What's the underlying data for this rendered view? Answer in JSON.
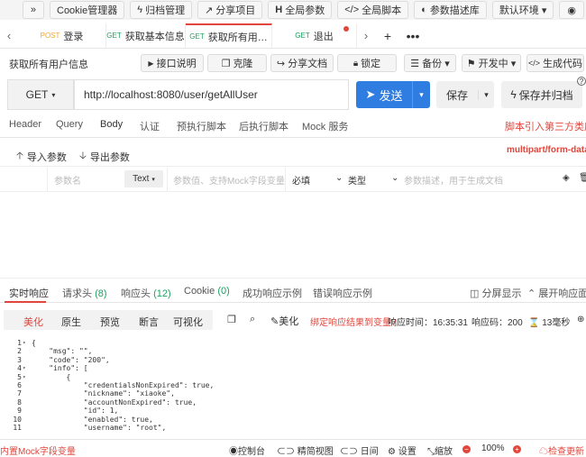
{
  "topbar": {
    "items": [
      {
        "icon": "»",
        "label": ""
      },
      {
        "icon": "",
        "label": "Cookie管理器"
      },
      {
        "icon": "ϟ",
        "label": "归档管理"
      },
      {
        "icon": "↗",
        "label": "分享项目"
      },
      {
        "icon": "H",
        "label": "全局参数"
      },
      {
        "icon": "</>",
        "label": "全局脚本"
      },
      {
        "icon": "◐",
        "label": "参数描述库"
      },
      {
        "icon": "",
        "label": "默认环境 ▾"
      },
      {
        "icon": "◉",
        "label": ""
      }
    ]
  },
  "tabs": [
    {
      "method": "POST",
      "label": "登录"
    },
    {
      "method": "GET",
      "label": "获取基本信息"
    },
    {
      "method": "GET",
      "label": "获取所有用…"
    },
    {
      "method": "GET",
      "label": "退出"
    }
  ],
  "api": {
    "title": "获取所有用户信息",
    "buttons": {
      "doc": "接口说明",
      "clone": "克隆",
      "share": "分享文档",
      "lock": "锁定",
      "backup": "备份 ▾",
      "dev": "开发中 ▾",
      "gencode": "生成代码"
    }
  },
  "url": {
    "method": "GET",
    "value": "http://localhost:8080/user/getAllUser",
    "send": "发送",
    "save": "保存",
    "save_archive": "保存并归档",
    "help": "?"
  },
  "reqtabs": [
    "Header",
    "Query",
    "Body",
    "认证",
    "预执行脚本",
    "后执行脚本",
    "Mock 服务"
  ],
  "reqtab_link": "脚本引入第三方类库?",
  "import_btn": "导入参数",
  "export_btn": "导出参数",
  "content_type": "multipart/form-data",
  "param_row": {
    "name_ph": "参数名",
    "type": "Text",
    "value_ph": "参数值、支持Mock字段变量",
    "required": "必填",
    "dtype": "类型",
    "desc_ph": "参数描述，用于生成文档"
  },
  "resptabs": [
    {
      "label": "实时响应",
      "count": ""
    },
    {
      "label": "请求头",
      "count": "(8)"
    },
    {
      "label": "响应头",
      "count": "(12)"
    },
    {
      "label": "Cookie",
      "count": "(0)"
    },
    {
      "label": "成功响应示例",
      "count": ""
    },
    {
      "label": "错误响应示例",
      "count": ""
    }
  ],
  "resp_right": {
    "split": "分屏显示",
    "expand": "展开响应面板"
  },
  "fmt": {
    "tabs": [
      "美化",
      "原生",
      "预览",
      "断言",
      "可视化"
    ],
    "beautify": "美化",
    "bind": "绑定响应结果到变量?",
    "time": "响应时间：16:35:31",
    "code": "响应码：200",
    "ms": "13毫秒"
  },
  "code_lines": [
    {
      "n": "1",
      "fold": "▾",
      "text": "{"
    },
    {
      "n": "2",
      "fold": "",
      "text": "    \"msg\": \"\","
    },
    {
      "n": "3",
      "fold": "",
      "text": "    \"code\": \"200\","
    },
    {
      "n": "4",
      "fold": "▾",
      "text": "    \"info\": ["
    },
    {
      "n": "5",
      "fold": "▾",
      "text": "        {"
    },
    {
      "n": "6",
      "fold": "",
      "text": "            \"credentialsNonExpired\": true,"
    },
    {
      "n": "7",
      "fold": "",
      "text": "            \"nickname\": \"xiaoke\","
    },
    {
      "n": "8",
      "fold": "",
      "text": "            \"accountNonExpired\": true,"
    },
    {
      "n": "9",
      "fold": "",
      "text": "            \"id\": 1,"
    },
    {
      "n": "10",
      "fold": "",
      "text": "            \"enabled\": true,"
    },
    {
      "n": "11",
      "fold": "",
      "text": "            \"username\": \"root\","
    }
  ],
  "status": {
    "left": "内置Mock字段变量",
    "console": "控制台",
    "simple": "精简视图",
    "night": "日间",
    "settings": "设置",
    "zoom": "缩放",
    "pct": "100%",
    "update": "检查更新"
  }
}
